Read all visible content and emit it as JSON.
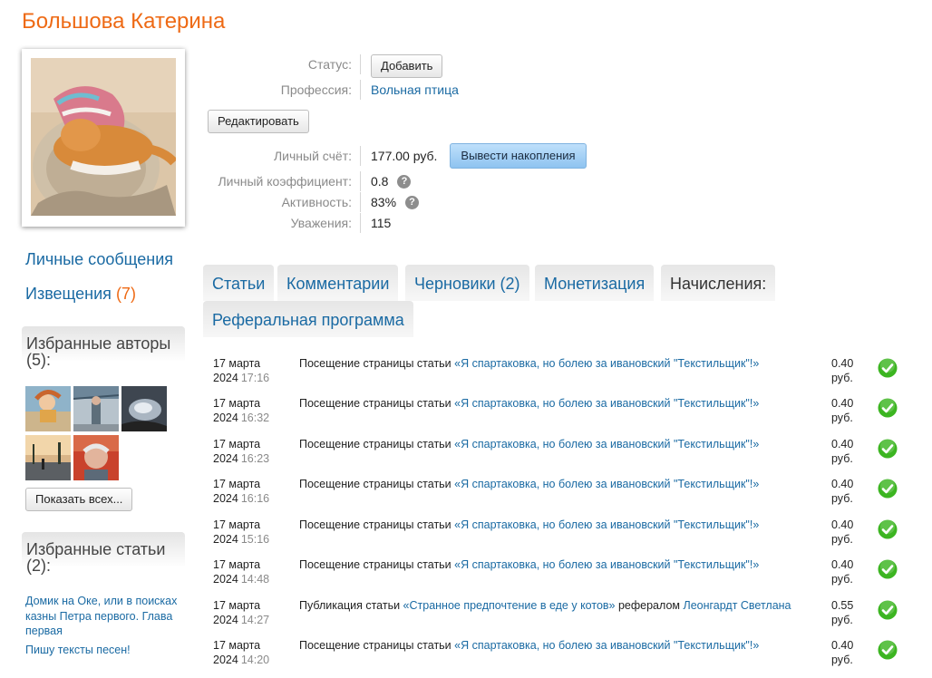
{
  "user": {
    "name": "Большова Катерина"
  },
  "profile": {
    "status_label": "Статус:",
    "status_button": "Добавить",
    "profession_label": "Профессия:",
    "profession_value": "Вольная птица",
    "edit_button": "Редактировать",
    "account_label": "Личный счёт:",
    "account_value": "177.00 руб.",
    "withdraw_button": "Вывести накопления",
    "coef_label": "Личный коэффициент:",
    "coef_value": "0.8",
    "activity_label": "Активность:",
    "activity_value": "83%",
    "respect_label": "Уважения:",
    "respect_value": "115"
  },
  "sidebar": {
    "messages_link": "Личные сообщения",
    "notices_link": "Извещения",
    "notices_count": "(7)",
    "fav_authors_title": "Избранные авторы (5):",
    "show_all_button": "Показать всех...",
    "fav_articles_title": "Избранные статьи (2):",
    "articles": [
      "Домик на Оке, или в поисках казны Петра первого. Глава первая",
      "Пишу тексты песен!"
    ]
  },
  "tabs": [
    {
      "label": "Статьи",
      "active": false
    },
    {
      "label": "Комментарии",
      "active": false
    },
    {
      "label": "Черновики (2)",
      "active": false
    },
    {
      "label": "Монетизация",
      "active": false
    },
    {
      "label": "Начисления:",
      "active": true
    },
    {
      "label": "Реферальная программа",
      "active": false
    }
  ],
  "transactions": [
    {
      "date": "17 марта",
      "year": "2024",
      "time": "17:16",
      "prefix": "Посещение страницы статьи",
      "link": "«Я спартаковка, но болею за ивановский \"Текстильщик\"!»",
      "middle": "",
      "link2": "",
      "amount": "0.40",
      "currency": "руб."
    },
    {
      "date": "17 марта",
      "year": "2024",
      "time": "16:32",
      "prefix": "Посещение страницы статьи",
      "link": "«Я спартаковка, но болею за ивановский \"Текстильщик\"!»",
      "middle": "",
      "link2": "",
      "amount": "0.40",
      "currency": "руб."
    },
    {
      "date": "17 марта",
      "year": "2024",
      "time": "16:23",
      "prefix": "Посещение страницы статьи",
      "link": "«Я спартаковка, но болею за ивановский \"Текстильщик\"!»",
      "middle": "",
      "link2": "",
      "amount": "0.40",
      "currency": "руб."
    },
    {
      "date": "17 марта",
      "year": "2024",
      "time": "16:16",
      "prefix": "Посещение страницы статьи",
      "link": "«Я спартаковка, но болею за ивановский \"Текстильщик\"!»",
      "middle": "",
      "link2": "",
      "amount": "0.40",
      "currency": "руб."
    },
    {
      "date": "17 марта",
      "year": "2024",
      "time": "15:16",
      "prefix": "Посещение страницы статьи",
      "link": "«Я спартаковка, но болею за ивановский \"Текстильщик\"!»",
      "middle": "",
      "link2": "",
      "amount": "0.40",
      "currency": "руб."
    },
    {
      "date": "17 марта",
      "year": "2024",
      "time": "14:48",
      "prefix": "Посещение страницы статьи",
      "link": "«Я спартаковка, но болею за ивановский \"Текстильщик\"!»",
      "middle": "",
      "link2": "",
      "amount": "0.40",
      "currency": "руб."
    },
    {
      "date": "17 марта",
      "year": "2024",
      "time": "14:27",
      "prefix": "Публикация статьи",
      "link": "«Странное предпочтение в еде у котов»",
      "middle": "рефералом",
      "link2": "Леонгардт Светлана",
      "amount": "0.55",
      "currency": "руб."
    },
    {
      "date": "17 марта",
      "year": "2024",
      "time": "14:20",
      "prefix": "Посещение страницы статьи",
      "link": "«Я спартаковка, но болею за ивановский \"Текстильщик\"!»",
      "middle": "",
      "link2": "",
      "amount": "0.40",
      "currency": "руб."
    }
  ],
  "colors": {
    "accent": "#ee6a15",
    "link": "#1a6aa3",
    "ok": "#3cb521"
  }
}
